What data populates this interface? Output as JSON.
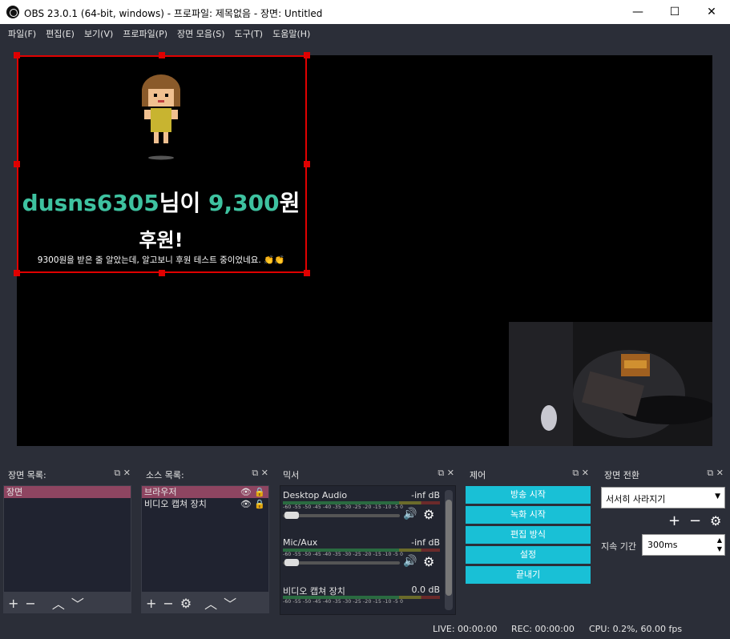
{
  "window": {
    "title": "OBS 23.0.1 (64-bit, windows) - 프로파일: 제목없음 - 장면: Untitled",
    "minimize": "—",
    "maximize": "☐",
    "close": "✕"
  },
  "menu": [
    "파일(F)",
    "편집(E)",
    "보기(V)",
    "프로파일(P)",
    "장면 모음(S)",
    "도구(T)",
    "도움말(H)"
  ],
  "donation": {
    "user": "dusns6305",
    "mid": "님이 ",
    "amount": "9,300",
    "suffix": "원",
    "line2": "후원!",
    "message": "9300원을 받은 줄 알았는데, 알고보니 후원 테스트 중이었네요. 👏👏"
  },
  "scenes": {
    "title": "장면 목록:",
    "items": [
      "장면"
    ]
  },
  "sources": {
    "title": "소스 목록:",
    "items": [
      "브라우저",
      "비디오 캡쳐 장치"
    ]
  },
  "mixer": {
    "title": "믹서",
    "channels": [
      {
        "name": "Desktop Audio",
        "db": "-inf dB"
      },
      {
        "name": "Mic/Aux",
        "db": "-inf dB"
      },
      {
        "name": "비디오 캡쳐 장치",
        "db": "0.0 dB"
      }
    ],
    "scale": "-60 -55 -50 -45 -40 -35 -30 -25 -20 -15 -10 -5 0"
  },
  "controls": {
    "title": "제어",
    "buttons": [
      "방송 시작",
      "녹화 시작",
      "편집 방식",
      "설정",
      "끝내기"
    ]
  },
  "transitions": {
    "title": "장면 전환",
    "selected": "서서히 사라지기",
    "duration_label": "지속 기간",
    "duration": "300ms"
  },
  "status": {
    "live": "LIVE: 00:00:00",
    "rec": "REC: 00:00:00",
    "cpu": "CPU: 0.2%, 60.00 fps"
  },
  "colors": {
    "accent": "#19c0d6",
    "selection": "#8e4561",
    "donation_green": "#3ec2a0",
    "selection_box": "#e00000"
  }
}
